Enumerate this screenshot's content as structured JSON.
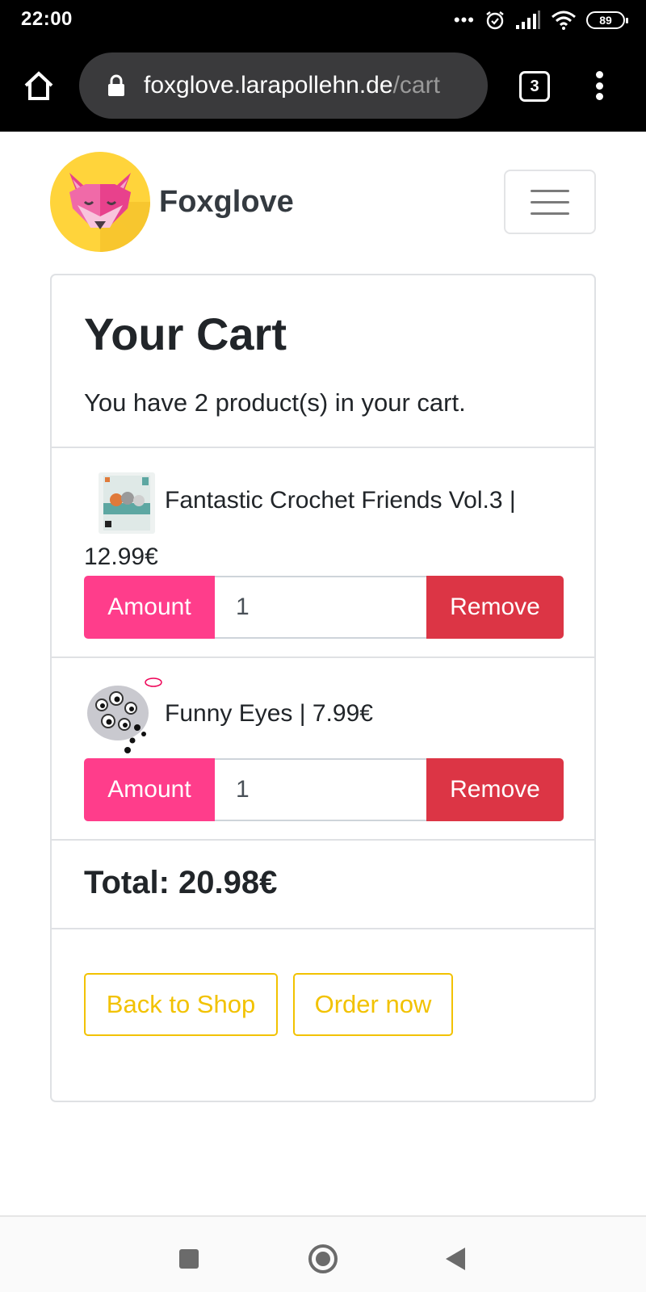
{
  "status_bar": {
    "time": "22:00",
    "dots": "•••",
    "battery": "89"
  },
  "browser": {
    "url_host": "foxglove.larapollehn.de",
    "url_path": "/cart",
    "tab_count": "3"
  },
  "navbar": {
    "brand_name": "Foxglove"
  },
  "cart": {
    "title": "Your Cart",
    "subtitle": "You have 2 product(s) in your cart.",
    "items": [
      {
        "line_1": "Fantastic Crochet Friends Vol.3 |",
        "line_2": "12.99€",
        "amount_label": "Amount",
        "quantity": "1",
        "remove_label": "Remove"
      },
      {
        "line_1": "Funny Eyes | 7.99€",
        "amount_label": "Amount",
        "quantity": "1",
        "remove_label": "Remove"
      }
    ],
    "total": "Total: 20.98€",
    "back_label": "Back to Shop",
    "order_label": "Order now"
  },
  "colors": {
    "amount": "#ff3d8b",
    "remove": "#dc3545",
    "outline_yellow": "#f2c200",
    "logo_yellow": "#ffd43b"
  },
  "icons": [
    "home-icon",
    "lock-icon",
    "tabs-icon",
    "more-vert-icon",
    "alarm-icon",
    "signal-icon",
    "wifi-icon",
    "hamburger-icon",
    "fox-logo-icon"
  ]
}
